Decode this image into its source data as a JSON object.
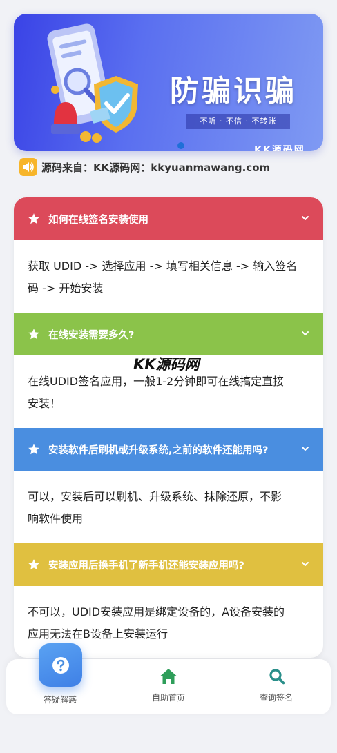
{
  "banner": {
    "title": "防骗识骗",
    "subtitle": "不听 · 不信 · 不转账",
    "brand": "KK源码网"
  },
  "notice": {
    "text": "源码来自：KK源码网：kkyuanmawang.com"
  },
  "watermark": "KK源码网",
  "faq": [
    {
      "question": "如何在线签名安装使用",
      "answer_line1": "获取 UDID -> 选择应用 -> 填写相关信息 -> 输入签名",
      "answer_line2": "码 -> 开始安装",
      "color": "#dc4a5a"
    },
    {
      "question": "在线安装需要多久?",
      "answer_line1": "在线UDID签名应用，一般1-2分钟即可在线搞定直接",
      "answer_line2": "安装！",
      "color": "#8bc34a"
    },
    {
      "question": "安装软件后刷机或升级系统,之前的软件还能用吗?",
      "answer_line1": "可以，安装后可以刷机、升级系统、抹除还原，不影",
      "answer_line2": "响软件使用",
      "color": "#4a8ee0"
    },
    {
      "question": "安装应用后换手机了新手机还能安装应用吗?",
      "answer_line1": "不可以，UDID安装应用是绑定设备的，A设备安装的",
      "answer_line2": "应用无法在B设备上安装运行",
      "color": "#e0c040"
    }
  ],
  "nav": {
    "items": [
      {
        "label": "答疑解惑",
        "icon": "question-circle-icon"
      },
      {
        "label": "自助首页",
        "icon": "home-icon",
        "color": "#2e9e5a"
      },
      {
        "label": "查询签名",
        "icon": "search-icon",
        "color": "#2a8f8a"
      }
    ]
  }
}
